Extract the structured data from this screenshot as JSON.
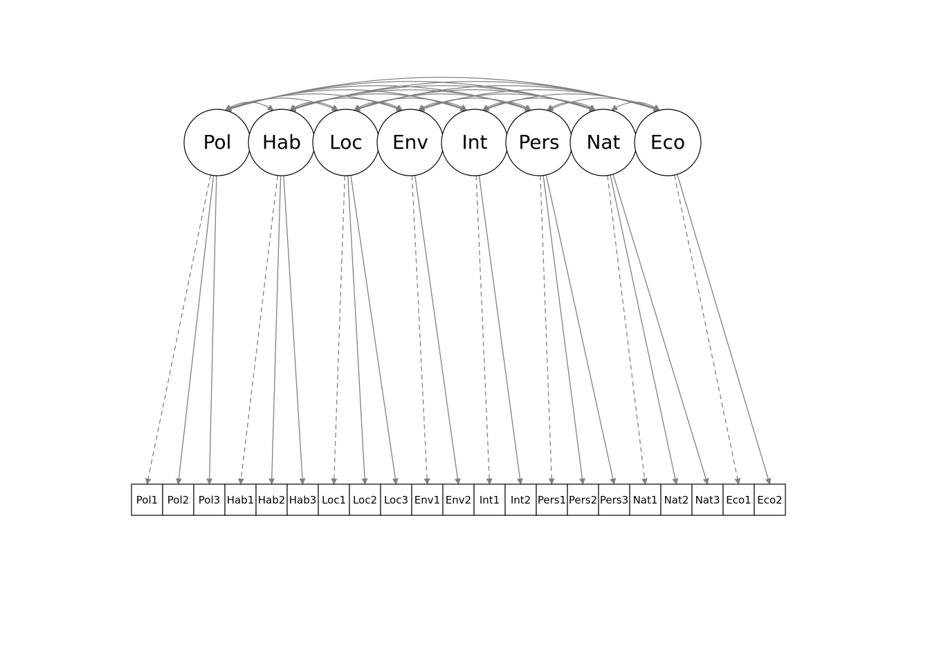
{
  "diagram": {
    "type": "sem-path-diagram",
    "latents": [
      {
        "id": "Pol",
        "label": "Pol"
      },
      {
        "id": "Hab",
        "label": "Hab"
      },
      {
        "id": "Loc",
        "label": "Loc"
      },
      {
        "id": "Env",
        "label": "Env"
      },
      {
        "id": "Int",
        "label": "Int"
      },
      {
        "id": "Pers",
        "label": "Pers"
      },
      {
        "id": "Nat",
        "label": "Nat"
      },
      {
        "id": "Eco",
        "label": "Eco"
      }
    ],
    "indicators": [
      {
        "id": "Pol1",
        "label": "Pol1",
        "parent": "Pol",
        "dashed": true
      },
      {
        "id": "Pol2",
        "label": "Pol2",
        "parent": "Pol",
        "dashed": false
      },
      {
        "id": "Pol3",
        "label": "Pol3",
        "parent": "Pol",
        "dashed": false
      },
      {
        "id": "Hab1",
        "label": "Hab1",
        "parent": "Hab",
        "dashed": true
      },
      {
        "id": "Hab2",
        "label": "Hab2",
        "parent": "Hab",
        "dashed": false
      },
      {
        "id": "Hab3",
        "label": "Hab3",
        "parent": "Hab",
        "dashed": false
      },
      {
        "id": "Loc1",
        "label": "Loc1",
        "parent": "Loc",
        "dashed": true
      },
      {
        "id": "Loc2",
        "label": "Loc2",
        "parent": "Loc",
        "dashed": false
      },
      {
        "id": "Loc3",
        "label": "Loc3",
        "parent": "Loc",
        "dashed": false
      },
      {
        "id": "Env1",
        "label": "Env1",
        "parent": "Env",
        "dashed": true
      },
      {
        "id": "Env2",
        "label": "Env2",
        "parent": "Env",
        "dashed": false
      },
      {
        "id": "Int1",
        "label": "Int1",
        "parent": "Int",
        "dashed": true
      },
      {
        "id": "Int2",
        "label": "Int2",
        "parent": "Int",
        "dashed": false
      },
      {
        "id": "Pers1",
        "label": "Pers1",
        "parent": "Pers",
        "dashed": true
      },
      {
        "id": "Pers2",
        "label": "Pers2",
        "parent": "Pers",
        "dashed": false
      },
      {
        "id": "Pers3",
        "label": "Pers3",
        "parent": "Pers",
        "dashed": false
      },
      {
        "id": "Nat1",
        "label": "Nat1",
        "parent": "Nat",
        "dashed": true
      },
      {
        "id": "Nat2",
        "label": "Nat2",
        "parent": "Nat",
        "dashed": false
      },
      {
        "id": "Nat3",
        "label": "Nat3",
        "parent": "Nat",
        "dashed": false
      },
      {
        "id": "Eco1",
        "label": "Eco1",
        "parent": "Eco",
        "dashed": true
      },
      {
        "id": "Eco2",
        "label": "Eco2",
        "parent": "Eco",
        "dashed": false
      }
    ],
    "note": "All latent pairs are connected by double-headed covariance curves at the top."
  }
}
